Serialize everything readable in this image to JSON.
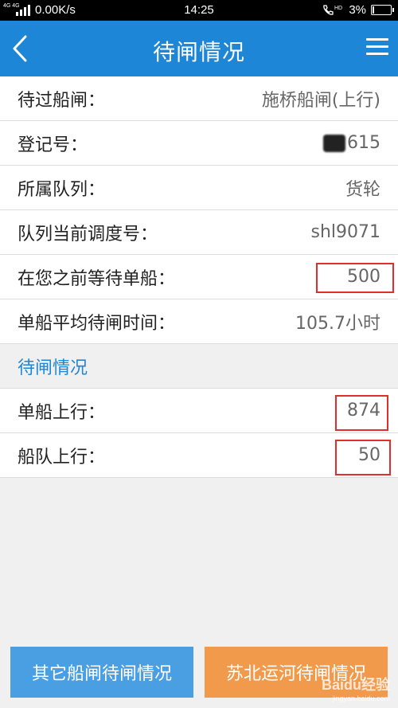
{
  "status_bar": {
    "network": "4G 4G",
    "speed": "0.00K/s",
    "time": "14:25",
    "hd": "HD",
    "battery": "3%"
  },
  "nav": {
    "title": "待闸情况"
  },
  "info": [
    {
      "label": "待过船闸：",
      "value": "施桥船闸(上行)"
    },
    {
      "label": "登记号：",
      "value": "615"
    },
    {
      "label": "所属队列：",
      "value": "货轮"
    },
    {
      "label": "队列当前调度号：",
      "value": "shl9071"
    },
    {
      "label": "在您之前等待单船：",
      "value": "500"
    },
    {
      "label": "单船平均待闸时间：",
      "value": "105.7小时"
    }
  ],
  "section_title": "待闸情况",
  "stats": [
    {
      "label": "单船上行：",
      "value": "874"
    },
    {
      "label": "船队上行：",
      "value": "50"
    }
  ],
  "buttons": {
    "other_locks": "其它船闸待闸情况",
    "subei_canal": "苏北运河待闸情况"
  },
  "watermark": {
    "brand": "Baidu经验",
    "url": "jingyan.baidu.com"
  },
  "colors": {
    "primary": "#1e86d6",
    "highlight": "#e22d2d",
    "button_blue": "#4a9fe3",
    "button_orange": "#f19a4b"
  }
}
